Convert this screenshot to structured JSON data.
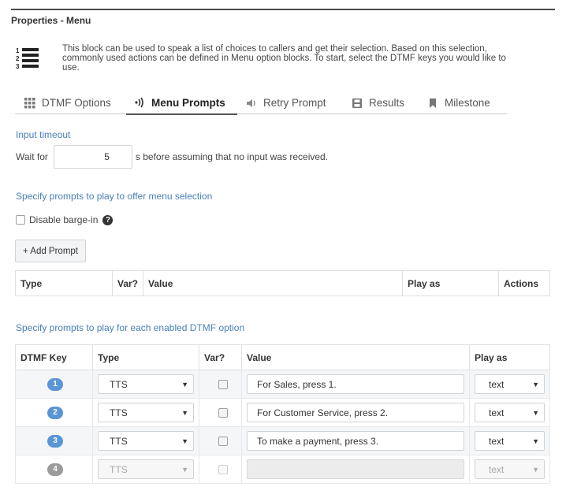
{
  "header": {
    "title": "Properties - Menu"
  },
  "description": "This block can be used to speak a list of choices to callers and get their selection. Based on this selection, commonly used actions can be defined in Menu option blocks. To start, select the DTMF keys you would like to use.",
  "tabs": [
    {
      "label": "DTMF Options",
      "icon": "grid-icon"
    },
    {
      "label": "Menu Prompts",
      "icon": "audio-waves-icon",
      "active": true
    },
    {
      "label": "Retry Prompt",
      "icon": "speaker-icon"
    },
    {
      "label": "Results",
      "icon": "save-icon"
    },
    {
      "label": "Milestone",
      "icon": "bookmark-icon"
    }
  ],
  "input_timeout": {
    "label": "Input timeout",
    "prefix": "Wait for",
    "value": "5",
    "suffix": "s before assuming that no input was received."
  },
  "menu_prompts": {
    "label": "Specify prompts to play to offer menu selection",
    "barge_in_label": "Disable barge-in",
    "help": "?",
    "add_button": "+ Add Prompt",
    "columns": [
      "Type",
      "Var?",
      "Value",
      "Play as",
      "Actions"
    ]
  },
  "dtmf_prompts": {
    "label": "Specify prompts to play for each enabled DTMF option",
    "columns": [
      "DTMF Key",
      "Type",
      "Var?",
      "Value",
      "Play as"
    ],
    "rows": [
      {
        "key": "1",
        "type": "TTS",
        "value": "For Sales, press 1.",
        "play_as": "text"
      },
      {
        "key": "2",
        "type": "TTS",
        "value": "For Customer Service, press 2.",
        "play_as": "text"
      },
      {
        "key": "3",
        "type": "TTS",
        "value": "To make a payment, press 3.",
        "play_as": "text"
      },
      {
        "key": "4",
        "type": "TTS",
        "value": "",
        "play_as": "text",
        "disabled": true
      }
    ]
  },
  "colors": {
    "accent": "#4a7fb5",
    "badge": "#5a95d6",
    "badge_disabled": "#9b9b9b"
  }
}
